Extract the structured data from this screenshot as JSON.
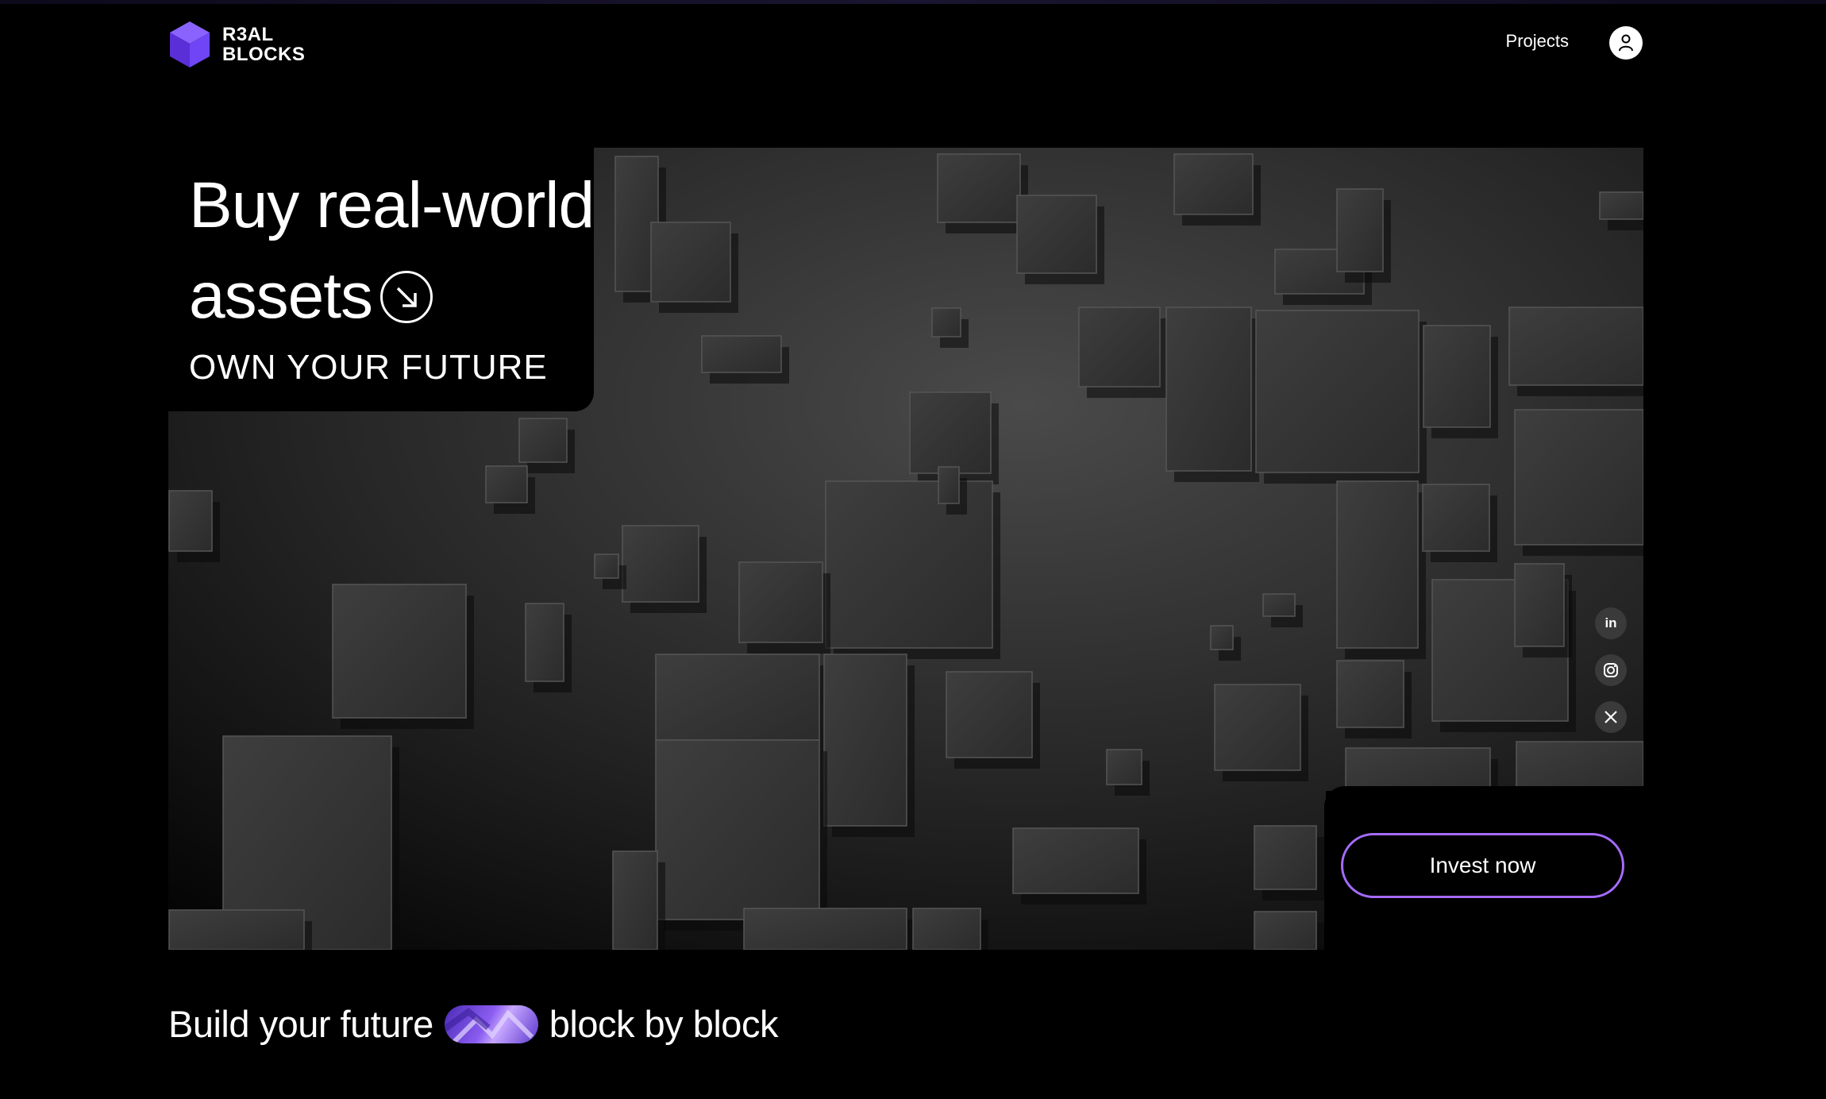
{
  "brand": {
    "name": "R3AL\nBLOCKS"
  },
  "nav": {
    "projects": "Projects"
  },
  "icons": {
    "logo": "cube-logo-icon",
    "user": "user-icon",
    "arrow": "arrow-down-right-icon",
    "linkedin": "linkedin-icon",
    "instagram": "instagram-icon",
    "x": "x-icon"
  },
  "hero": {
    "headline_line1": "Buy real-world",
    "headline_line2": "assets",
    "tagline": "OWN YOUR FUTURE",
    "cta": "Invest now"
  },
  "social": {
    "linkedin": "in"
  },
  "bottom": {
    "left": "Build your future",
    "right": "block by block"
  },
  "colors": {
    "accent": "#a56bff",
    "background": "#000000",
    "logo": "#6b3df0"
  }
}
